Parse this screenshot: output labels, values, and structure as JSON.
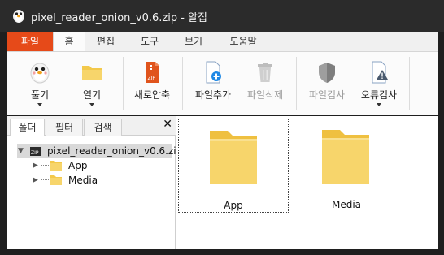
{
  "window": {
    "title": "pixel_reader_onion_v0.6.zip - 알집",
    "app_icon": "penguin-mascot-icon"
  },
  "ribbon_tabs": [
    {
      "label": "파일"
    },
    {
      "label": "홈"
    },
    {
      "label": "편집"
    },
    {
      "label": "도구"
    },
    {
      "label": "보기"
    },
    {
      "label": "도움말"
    }
  ],
  "ribbon": {
    "extract": {
      "label": "풀기",
      "icon": "extract-mascot-icon"
    },
    "open": {
      "label": "열기",
      "icon": "open-folder-icon"
    },
    "new_zip": {
      "label": "새로압축",
      "icon": "zip-file-icon"
    },
    "add_file": {
      "label": "파일추가",
      "icon": "add-file-icon"
    },
    "delete_file": {
      "label": "파일삭제",
      "icon": "trash-icon"
    },
    "check_file": {
      "label": "파일검사",
      "icon": "shield-icon"
    },
    "error_check": {
      "label": "오류검사",
      "icon": "warning-file-icon"
    }
  },
  "left_tabs": [
    {
      "label": "폴더"
    },
    {
      "label": "필터"
    },
    {
      "label": "검색"
    }
  ],
  "left_close": "✕",
  "tree": {
    "root": "pixel_reader_onion_v0.6.zip",
    "children": [
      {
        "label": "App"
      },
      {
        "label": "Media"
      }
    ]
  },
  "items": [
    {
      "name": "App",
      "icon": "folder-icon"
    },
    {
      "name": "Media",
      "icon": "folder-icon"
    }
  ],
  "colors": {
    "file_tab": "#e64a19",
    "folder_yellow": "#f7d56b",
    "title_bar": "#2b2b2b"
  }
}
